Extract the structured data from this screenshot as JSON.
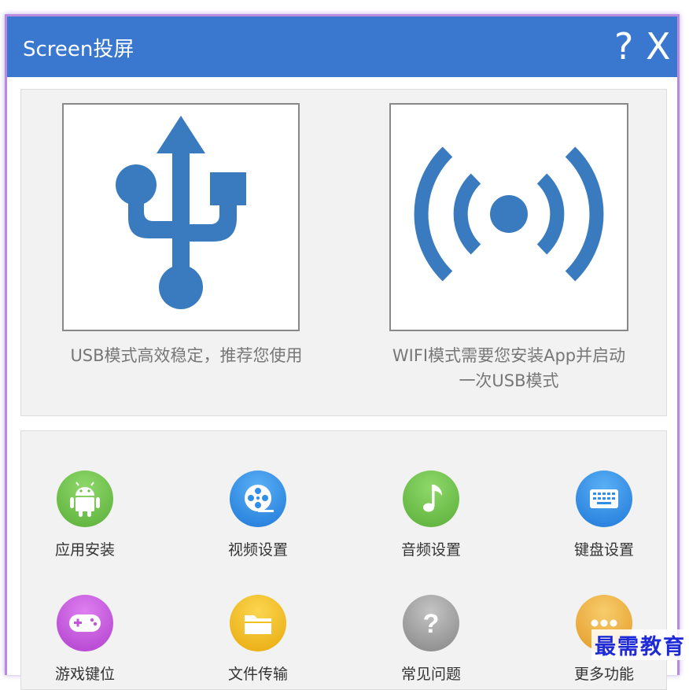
{
  "window": {
    "title": "Screen投屏",
    "help_label": "?",
    "close_label": "X"
  },
  "modes": {
    "usb": {
      "icon": "usb-icon",
      "description": "USB模式高效稳定，推荐您使用"
    },
    "wifi": {
      "icon": "wifi-signal-icon",
      "description_line1": "WIFI模式需要您安装App并启动",
      "description_line2": "一次USB模式"
    }
  },
  "functions": [
    {
      "label": "应用安装",
      "icon": "android-icon",
      "color": "#6cc04a"
    },
    {
      "label": "视频设置",
      "icon": "film-reel-icon",
      "color": "#2f8fe8"
    },
    {
      "label": "音频设置",
      "icon": "music-note-icon",
      "color": "#6cc04a"
    },
    {
      "label": "键盘设置",
      "icon": "keyboard-icon",
      "color": "#2f8fe8"
    },
    {
      "label": "游戏键位",
      "icon": "gamepad-icon",
      "color": "#c455d8"
    },
    {
      "label": "文件传输",
      "icon": "folder-icon",
      "color": "#f2c01c"
    },
    {
      "label": "常见问题",
      "icon": "question-icon",
      "color": "#9a9a9a"
    },
    {
      "label": "更多功能",
      "icon": "more-icon",
      "color": "#f0b040"
    }
  ],
  "watermark": "最需教育",
  "colors": {
    "titlebar": "#3a78d0",
    "icon_blue": "#3a7bc0",
    "window_border": "#b98be0"
  }
}
